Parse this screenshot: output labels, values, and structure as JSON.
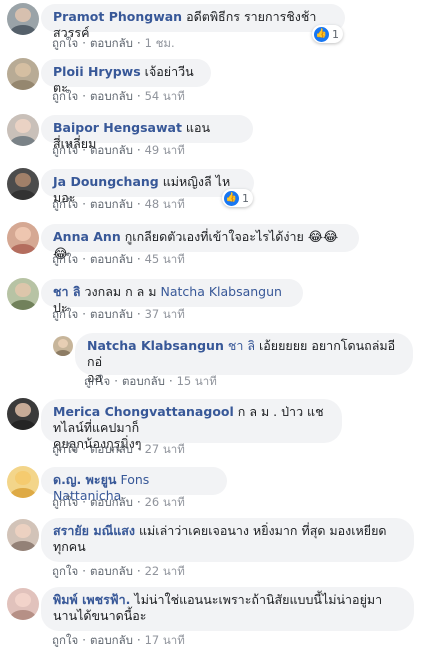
{
  "actions": {
    "like": "ถูกใจ",
    "reply": "ตอบกลับ",
    "sep": "·"
  },
  "comments": [
    {
      "name": "Pramot Phongwan",
      "tag": "",
      "text": "อดีตพิธีกร รายการชิงช้าสวรรค์",
      "time": "1 ชม.",
      "reaction_count": "1"
    },
    {
      "name": "Ploii Hrypws",
      "tag": "",
      "text": "เจ้อย่าวีนตะ",
      "time": "54 นาที"
    },
    {
      "name": "Baipor Hengsawat",
      "tag": "",
      "text": "แอน สี่เหลี่ยม",
      "time": "49 นาที"
    },
    {
      "name": "Ja Doungchang",
      "tag": "",
      "text": "แม่หญิงลี ไหมอะ",
      "time": "48 นาที",
      "reaction_count": "1"
    },
    {
      "name": "Anna Ann",
      "tag": "",
      "text": "กูเกลียดตัวเองที่เข้าใจอะไรได้ง่าย",
      "emoji": "😂😂😂",
      "time": "45 นาที"
    },
    {
      "name": "ชา ลิ",
      "tag": "Natcha Klabsangun",
      "text_before": "วงกลม ก ล ม",
      "text": "ปะ",
      "time": "37 นาที"
    },
    {
      "name": "Natcha Klabsangun",
      "tag": "ชา ลิ",
      "text_line1": "เอ้ยยยยย อยากโดนถล่มอีกอ่",
      "text_line2": "ออ",
      "time": "15 นาที"
    },
    {
      "name": "Merica Chongvattanagool",
      "tag": "",
      "text_line1": "ก ล ม . ป่าว แชทไลน์ที่แคปมาก็",
      "text_line2": "คุยลูกน้องกุรุมิ่งๆ",
      "time": "27 นาที"
    },
    {
      "name": "ด.ญ. พะยูน",
      "tag": "Fons Nattanicha",
      "text": "",
      "time": "26 นาที"
    },
    {
      "name": "สรายัย มณีแสง",
      "tag": "",
      "text_line1": "แม่เล่าว่าเคยเจอนาง หยิ่งมาก ที่สุด มองเหยียด",
      "text_line2": "ทุกคน",
      "time": "22 นาที"
    },
    {
      "name": "พิมพ์ เพชรฟ้า.",
      "tag": "",
      "text_line1": "ไม่น่าใช่แอนนะเพราะถ้านิสัยแบบนี้ไม่น่าอยู่มา",
      "text_line2": "นานได้ขนาดนี้อะ",
      "time": "17 นาที"
    }
  ],
  "colors": {
    "link": "#385898",
    "bubble": "#f2f3f5",
    "meta": "#606770",
    "like": "#1877f2"
  }
}
